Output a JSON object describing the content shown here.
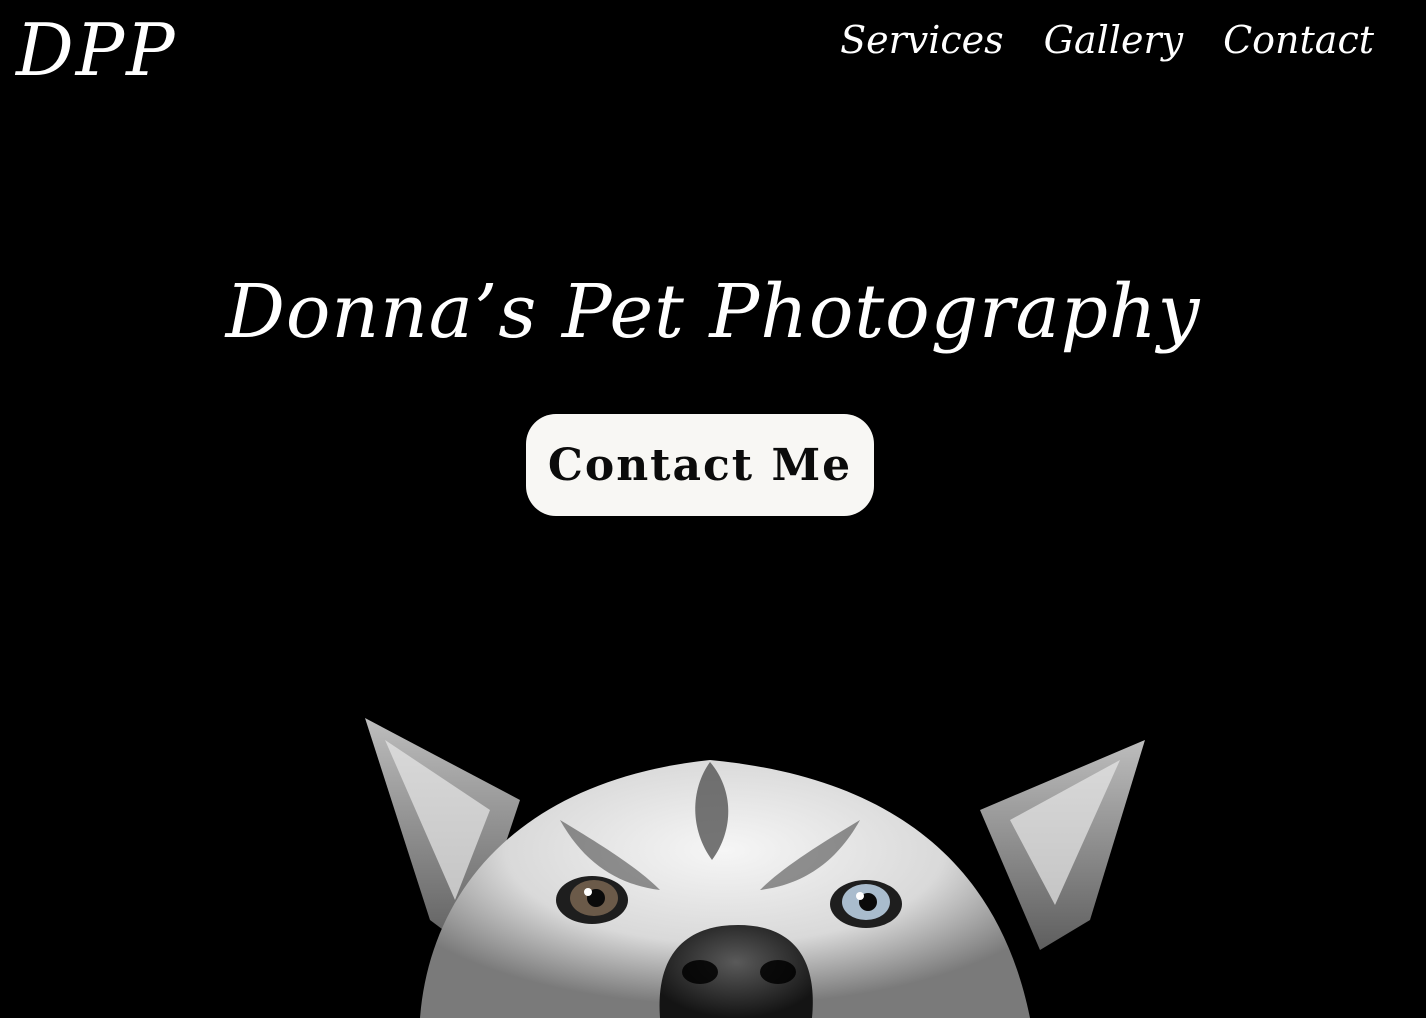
{
  "header": {
    "logo_text": "DPP",
    "nav": [
      {
        "label": "Services"
      },
      {
        "label": "Gallery"
      },
      {
        "label": "Contact"
      }
    ]
  },
  "hero": {
    "title": "Donna’s Pet Photography",
    "cta_label": "Contact Me",
    "image_subject": "husky-face-peeking-from-bottom"
  },
  "colors": {
    "background": "#000000",
    "text": "#ffffff",
    "button_bg": "#f8f7f4",
    "button_text": "#0b0b0b"
  }
}
